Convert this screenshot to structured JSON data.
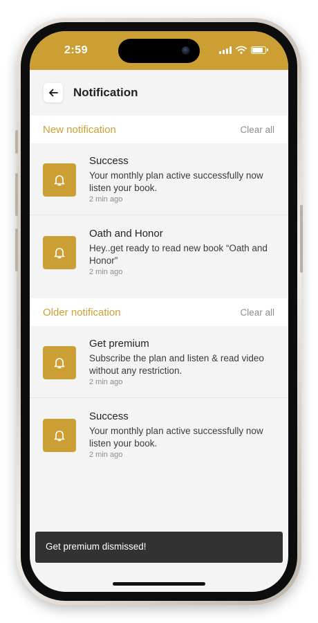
{
  "status_bar": {
    "time": "2:59",
    "icons": [
      "cellular-signal-icon",
      "wifi-icon",
      "battery-icon"
    ],
    "battery_level": 0.85
  },
  "header": {
    "back_icon": "arrow-left-icon",
    "title": "Notification"
  },
  "sections": [
    {
      "title": "New notification",
      "clear_label": "Clear all",
      "items": [
        {
          "icon": "bell-icon",
          "title": "Success",
          "body": "Your monthly plan active successfully now listen your book.",
          "time": "2 min ago"
        },
        {
          "icon": "bell-icon",
          "title": "Oath and Honor",
          "body": "Hey..get ready to read new book “Oath and Honor”",
          "time": "2 min ago"
        }
      ]
    },
    {
      "title": "Older notification",
      "clear_label": "Clear all",
      "items": [
        {
          "icon": "bell-icon",
          "title": "Get premium",
          "body": "Subscribe the plan and listen & read video without any restriction.",
          "time": "2 min ago"
        },
        {
          "icon": "bell-icon",
          "title": "Success",
          "body": "Your monthly plan active successfully now listen your book.",
          "time": "2 min ago"
        }
      ]
    }
  ],
  "snackbar": {
    "message": "Get premium dismissed!"
  },
  "colors": {
    "accent": "#cc9f34",
    "background": "#f4f4f4",
    "snackbar": "#323232"
  }
}
